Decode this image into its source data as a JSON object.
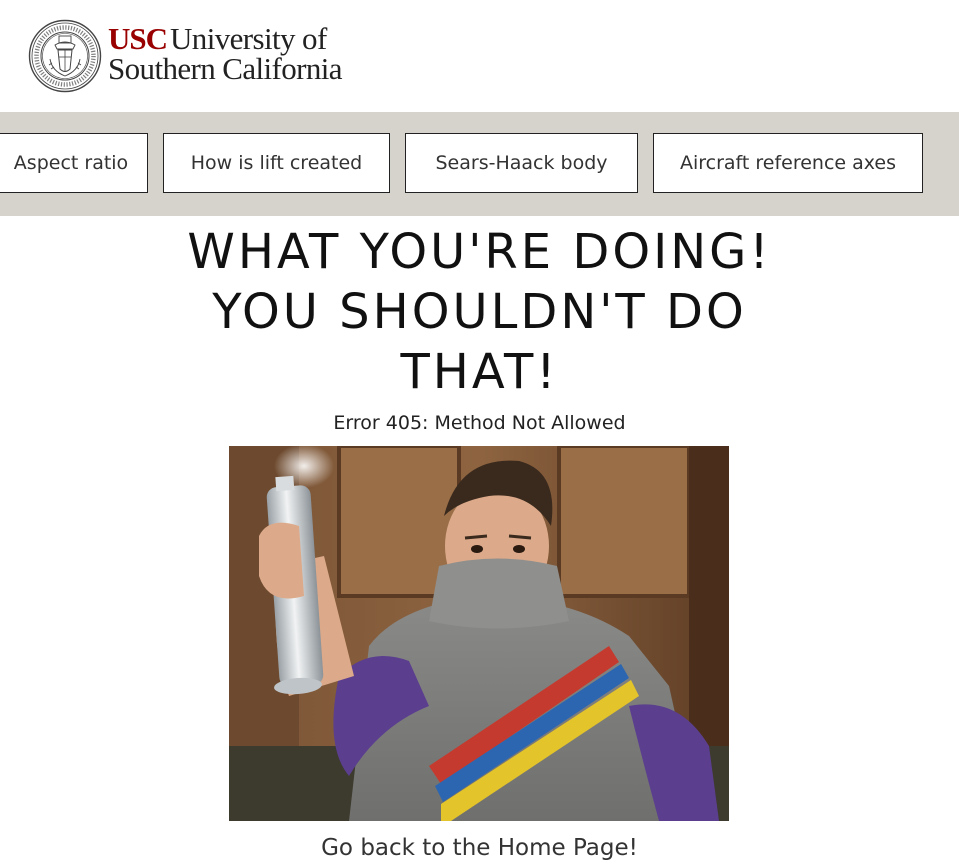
{
  "header": {
    "logo": {
      "abbr": "USC",
      "line1_rest": "University of",
      "line2": "Southern California",
      "seal_icon": "usc-seal-icon",
      "seal_text": "UNIVERSITY OF SOUTHERN CALIFORNIA 1880",
      "brand_color": "#990000"
    }
  },
  "nav": {
    "background": "#d6d2cc",
    "items": [
      {
        "label": "Aspect ratio"
      },
      {
        "label": "How is lift created"
      },
      {
        "label": "Sears-Haack body"
      },
      {
        "label": "Aircraft reference axes"
      }
    ]
  },
  "main": {
    "headline_lines": [
      "WHAT YOU'RE DOING!",
      "YOU SHOULDN'T DO",
      "THAT!"
    ],
    "error_message": "Error 405: Method Not Allowed",
    "image_description_icon": "meme-photo-spray-can",
    "home_link_label": "Go back to the Home Page!"
  }
}
